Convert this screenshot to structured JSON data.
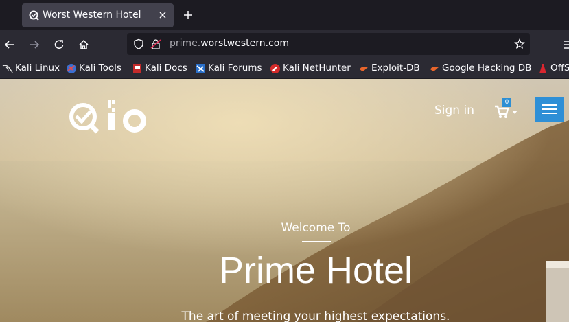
{
  "browser": {
    "tab": {
      "title": "Worst Western Hotel"
    },
    "url": {
      "subdomain": "prime.",
      "domain": "worstwestern.com"
    },
    "bookmarks": [
      {
        "label": "Kali Linux",
        "icon": "kali-dragon-icon"
      },
      {
        "label": "Kali Tools",
        "icon": "kali-tools-icon"
      },
      {
        "label": "Kali Docs",
        "icon": "kali-docs-icon"
      },
      {
        "label": "Kali Forums",
        "icon": "kali-forums-icon"
      },
      {
        "label": "Kali NetHunter",
        "icon": "kali-nethunter-icon"
      },
      {
        "label": "Exploit-DB",
        "icon": "exploit-db-icon"
      },
      {
        "label": "Google Hacking DB",
        "icon": "ghdb-icon"
      },
      {
        "label": "OffS",
        "icon": "offsec-icon"
      }
    ]
  },
  "site": {
    "logo_text": "Qlo",
    "signin": "Sign in",
    "cart_count": "0",
    "hero": {
      "welcome": "Welcome To",
      "title": "Prime Hotel",
      "tagline": "The art of meeting your highest expectations."
    }
  },
  "colors": {
    "accent": "#2e8fd6",
    "tab_bg": "#42414d",
    "toolbar_bg": "#2b2a33"
  }
}
